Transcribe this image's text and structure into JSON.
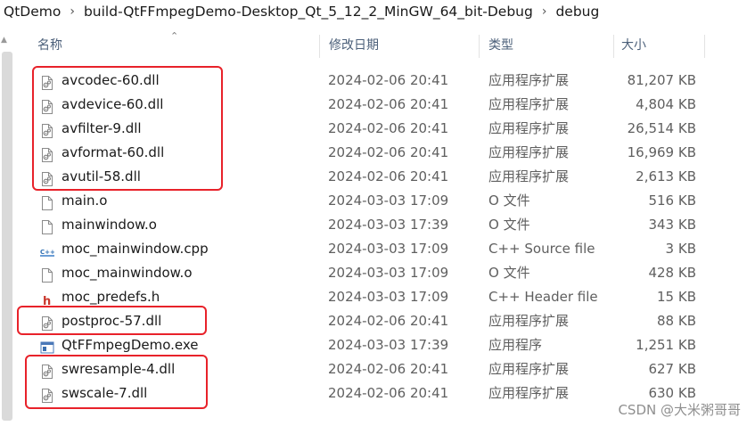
{
  "breadcrumb": [
    "QtDemo",
    "build-QtFFmpegDemo-Desktop_Qt_5_12_2_MinGW_64_bit-Debug",
    "debug"
  ],
  "columns": {
    "name": "名称",
    "date": "修改日期",
    "type": "类型",
    "size": "大小"
  },
  "files": [
    {
      "name": "avcodec-60.dll",
      "date": "2024-02-06 20:41",
      "type": "应用程序扩展",
      "size": "81,207 KB",
      "icon": "dll-icon"
    },
    {
      "name": "avdevice-60.dll",
      "date": "2024-02-06 20:41",
      "type": "应用程序扩展",
      "size": "4,804 KB",
      "icon": "dll-icon"
    },
    {
      "name": "avfilter-9.dll",
      "date": "2024-02-06 20:41",
      "type": "应用程序扩展",
      "size": "26,514 KB",
      "icon": "dll-icon"
    },
    {
      "name": "avformat-60.dll",
      "date": "2024-02-06 20:41",
      "type": "应用程序扩展",
      "size": "16,969 KB",
      "icon": "dll-icon"
    },
    {
      "name": "avutil-58.dll",
      "date": "2024-02-06 20:41",
      "type": "应用程序扩展",
      "size": "2,613 KB",
      "icon": "dll-icon"
    },
    {
      "name": "main.o",
      "date": "2024-03-03 17:09",
      "type": "O 文件",
      "size": "516 KB",
      "icon": "blank-file-icon"
    },
    {
      "name": "mainwindow.o",
      "date": "2024-03-03 17:39",
      "type": "O 文件",
      "size": "343 KB",
      "icon": "blank-file-icon"
    },
    {
      "name": "moc_mainwindow.cpp",
      "date": "2024-03-03 17:09",
      "type": "C++ Source file",
      "size": "3 KB",
      "icon": "cpp-file-icon"
    },
    {
      "name": "moc_mainwindow.o",
      "date": "2024-03-03 17:09",
      "type": "O 文件",
      "size": "428 KB",
      "icon": "blank-file-icon"
    },
    {
      "name": "moc_predefs.h",
      "date": "2024-03-03 17:09",
      "type": "C++ Header file",
      "size": "15 KB",
      "icon": "header-file-icon"
    },
    {
      "name": "postproc-57.dll",
      "date": "2024-02-06 20:41",
      "type": "应用程序扩展",
      "size": "88 KB",
      "icon": "dll-icon"
    },
    {
      "name": "QtFFmpegDemo.exe",
      "date": "2024-03-03 17:39",
      "type": "应用程序",
      "size": "1,251 KB",
      "icon": "exe-icon"
    },
    {
      "name": "swresample-4.dll",
      "date": "2024-02-06 20:41",
      "type": "应用程序扩展",
      "size": "627 KB",
      "icon": "dll-icon"
    },
    {
      "name": "swscale-7.dll",
      "date": "2024-02-06 20:41",
      "type": "应用程序扩展",
      "size": "630 KB",
      "icon": "dll-icon"
    }
  ],
  "highlight_color": "#e8222a",
  "watermark": "CSDN @大米粥哥哥"
}
